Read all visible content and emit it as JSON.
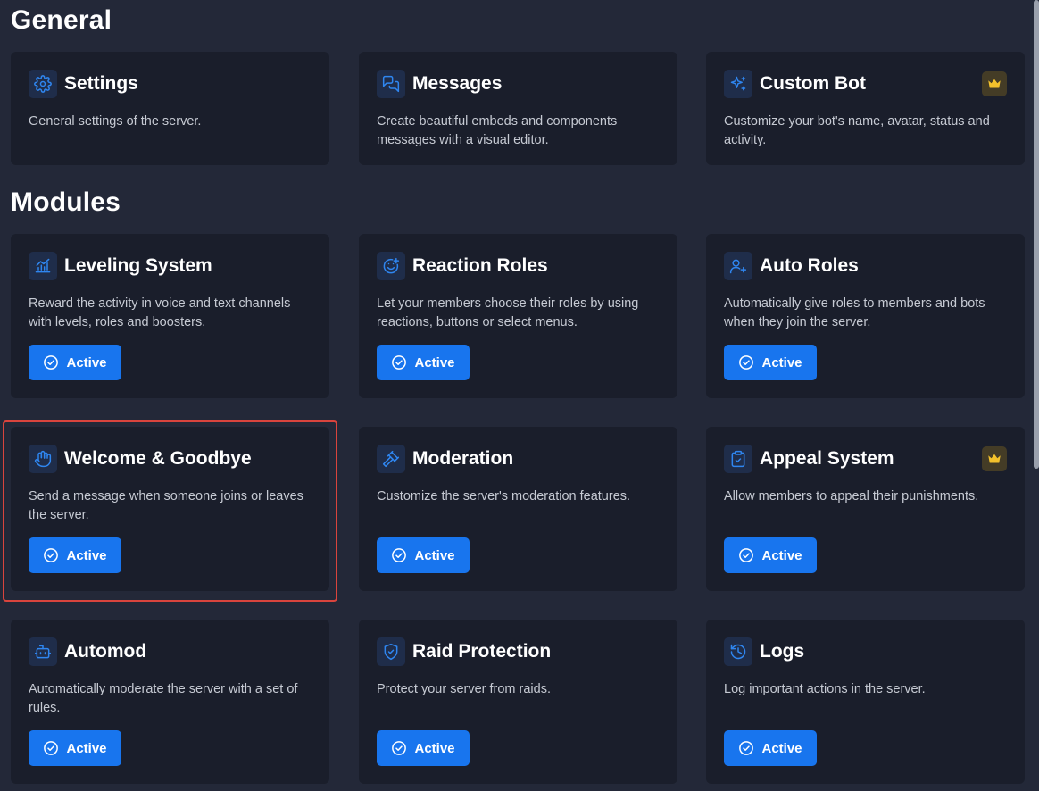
{
  "sections": {
    "general": "General",
    "modules": "Modules"
  },
  "cards": {
    "settings": {
      "icon": "gear-icon",
      "title": "Settings",
      "description": "General settings of the server."
    },
    "messages": {
      "icon": "chat-bubbles-icon",
      "title": "Messages",
      "description": "Create beautiful embeds and components messages with a visual editor."
    },
    "custom_bot": {
      "icon": "sparkles-icon",
      "title": "Custom Bot",
      "description": "Customize your bot's name, avatar, status and activity.",
      "premium": true
    },
    "leveling": {
      "icon": "chart-icon",
      "title": "Leveling System",
      "description": "Reward the activity in voice and text channels with levels, roles and boosters.",
      "status": "Active"
    },
    "reaction_roles": {
      "icon": "smiley-plus-icon",
      "title": "Reaction Roles",
      "description": "Let your members choose their roles by using reactions, buttons or select menus.",
      "status": "Active"
    },
    "auto_roles": {
      "icon": "user-plus-icon",
      "title": "Auto Roles",
      "description": "Automatically give roles to members and bots when they join the server.",
      "status": "Active"
    },
    "welcome": {
      "icon": "waving-hand-icon",
      "title": "Welcome & Goodbye",
      "description": "Send a message when someone joins or leaves the server.",
      "status": "Active"
    },
    "moderation": {
      "icon": "gavel-icon",
      "title": "Moderation",
      "description": "Customize the server's moderation features.",
      "status": "Active"
    },
    "appeal": {
      "icon": "clipboard-check-icon",
      "title": "Appeal System",
      "description": "Allow members to appeal their punishments.",
      "status": "Active",
      "premium": true
    },
    "automod": {
      "icon": "robot-icon",
      "title": "Automod",
      "description": "Automatically moderate the server with a set of rules.",
      "status": "Active"
    },
    "raid": {
      "icon": "shield-check-icon",
      "title": "Raid Protection",
      "description": "Protect your server from raids.",
      "status": "Active"
    },
    "logs": {
      "icon": "history-icon",
      "title": "Logs",
      "description": "Log important actions in the server.",
      "status": "Active"
    }
  },
  "colors": {
    "background": "#232838",
    "card": "#1a1e2b",
    "accent": "#1875ee",
    "premium": "#f3c12c",
    "highlight": "#d9443d"
  }
}
